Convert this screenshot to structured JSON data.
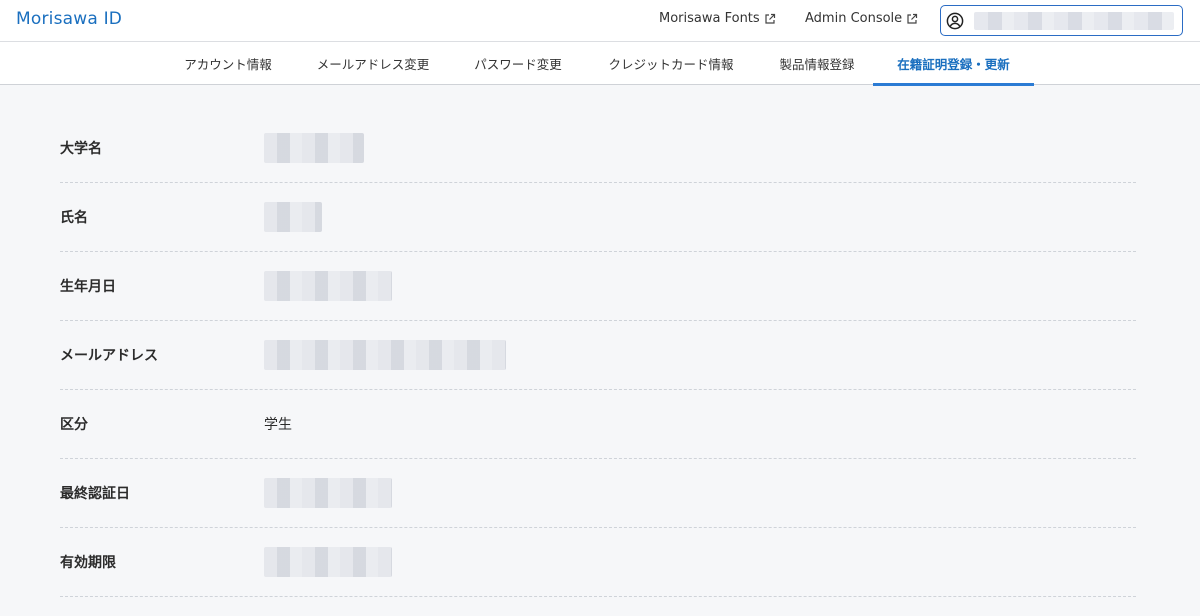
{
  "header": {
    "logo": "Morisawa ID",
    "links": [
      {
        "label": "Morisawa Fonts",
        "icon": "external-link-icon"
      },
      {
        "label": "Admin Console",
        "icon": "external-link-icon"
      }
    ],
    "account_icon": "user-circle-icon",
    "accent_color": "#1a6fbf"
  },
  "tabs": [
    {
      "label": "アカウント情報"
    },
    {
      "label": "メールアドレス変更"
    },
    {
      "label": "パスワード変更"
    },
    {
      "label": "クレジットカード情報"
    },
    {
      "label": "製品情報登録"
    },
    {
      "label": "在籍証明登録・更新",
      "active": true
    }
  ],
  "rows": [
    {
      "label": "大学名"
    },
    {
      "label": "氏名"
    },
    {
      "label": "生年月日"
    },
    {
      "label": "メールアドレス"
    },
    {
      "label": "区分",
      "value": "学生"
    },
    {
      "label": "最終認証日"
    },
    {
      "label": "有効期限"
    }
  ]
}
